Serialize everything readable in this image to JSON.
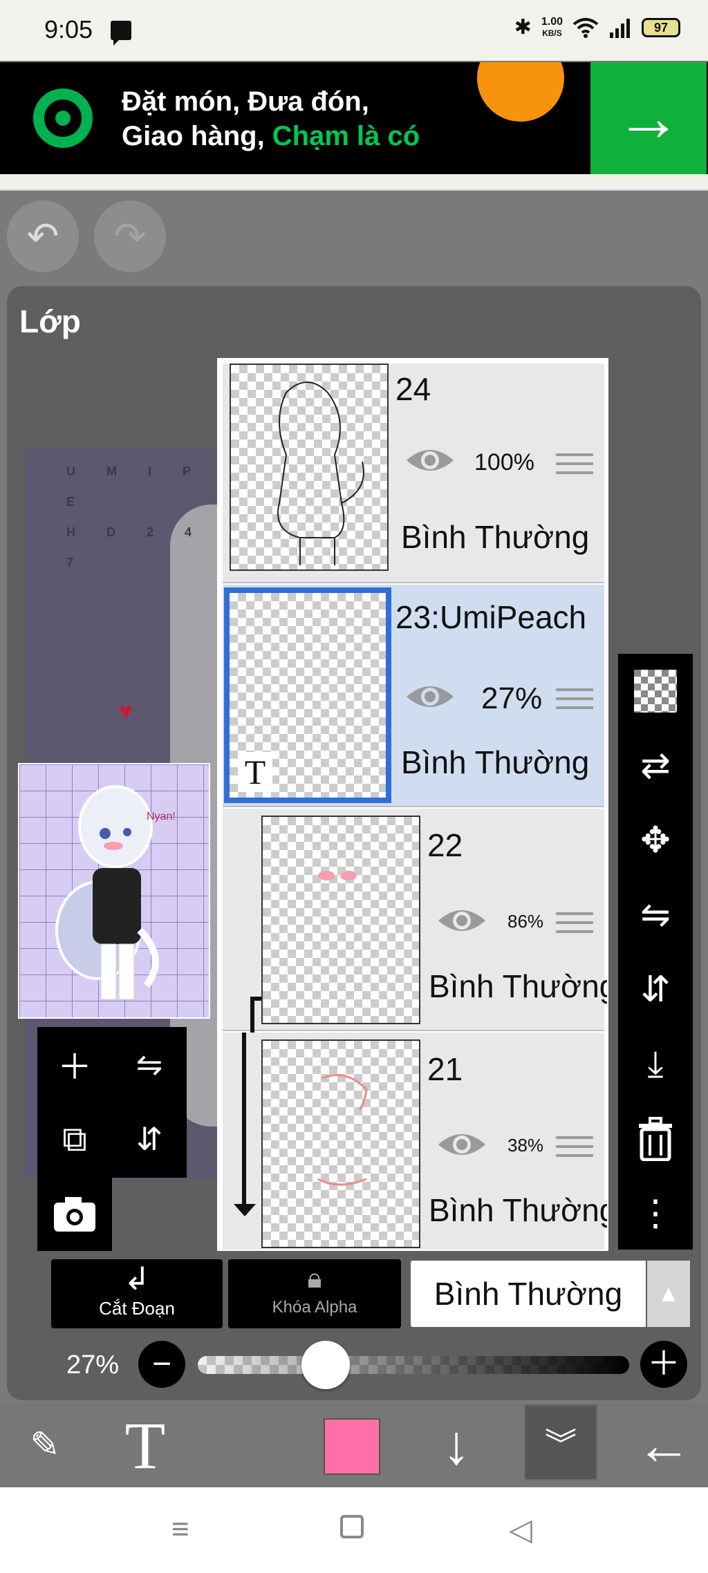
{
  "status_bar": {
    "time": "9:05",
    "network_speed_value": "1.00",
    "network_speed_unit": "KB/S",
    "battery": "97",
    "icons": [
      "message-icon",
      "bluetooth-icon",
      "wifi-icon",
      "signal-icon",
      "battery-icon"
    ]
  },
  "ad": {
    "line1": "Đặt món, Đưa đón,",
    "line2_prefix": "Giao hàng, ",
    "line2_highlight": "Chạm là có",
    "arrow": "→",
    "brand_color": "#00b14f"
  },
  "panel": {
    "title": "Lớp"
  },
  "canvas": {
    "watermark_line1": "U M I P E",
    "watermark_line2": "H D 2 4 7"
  },
  "navigator": {
    "signature": "Nyan!"
  },
  "layers": [
    {
      "name": "24",
      "opacity": "100%",
      "blend": "Bình Thường",
      "selected": false,
      "clipped": false
    },
    {
      "name": "23:UmiPeach",
      "opacity": "27%",
      "blend": "Bình Thường",
      "selected": true,
      "clipped": false,
      "text_layer_badge": "T"
    },
    {
      "name": "22",
      "opacity": "86%",
      "blend": "Bình Thường",
      "selected": false,
      "clipped": true
    },
    {
      "name": "21",
      "opacity": "38%",
      "blend": "Bình Thường",
      "selected": false,
      "clipped": true
    }
  ],
  "controls": {
    "clip_label": "Cắt Đoạn",
    "alpha_lock_label": "Khóa Alpha",
    "blend_mode": "Bình Thường",
    "opacity_value": "27%",
    "opacity_fraction": 0.27,
    "accent_color": "#2f6fd6",
    "current_color": "#ff6fa8"
  }
}
